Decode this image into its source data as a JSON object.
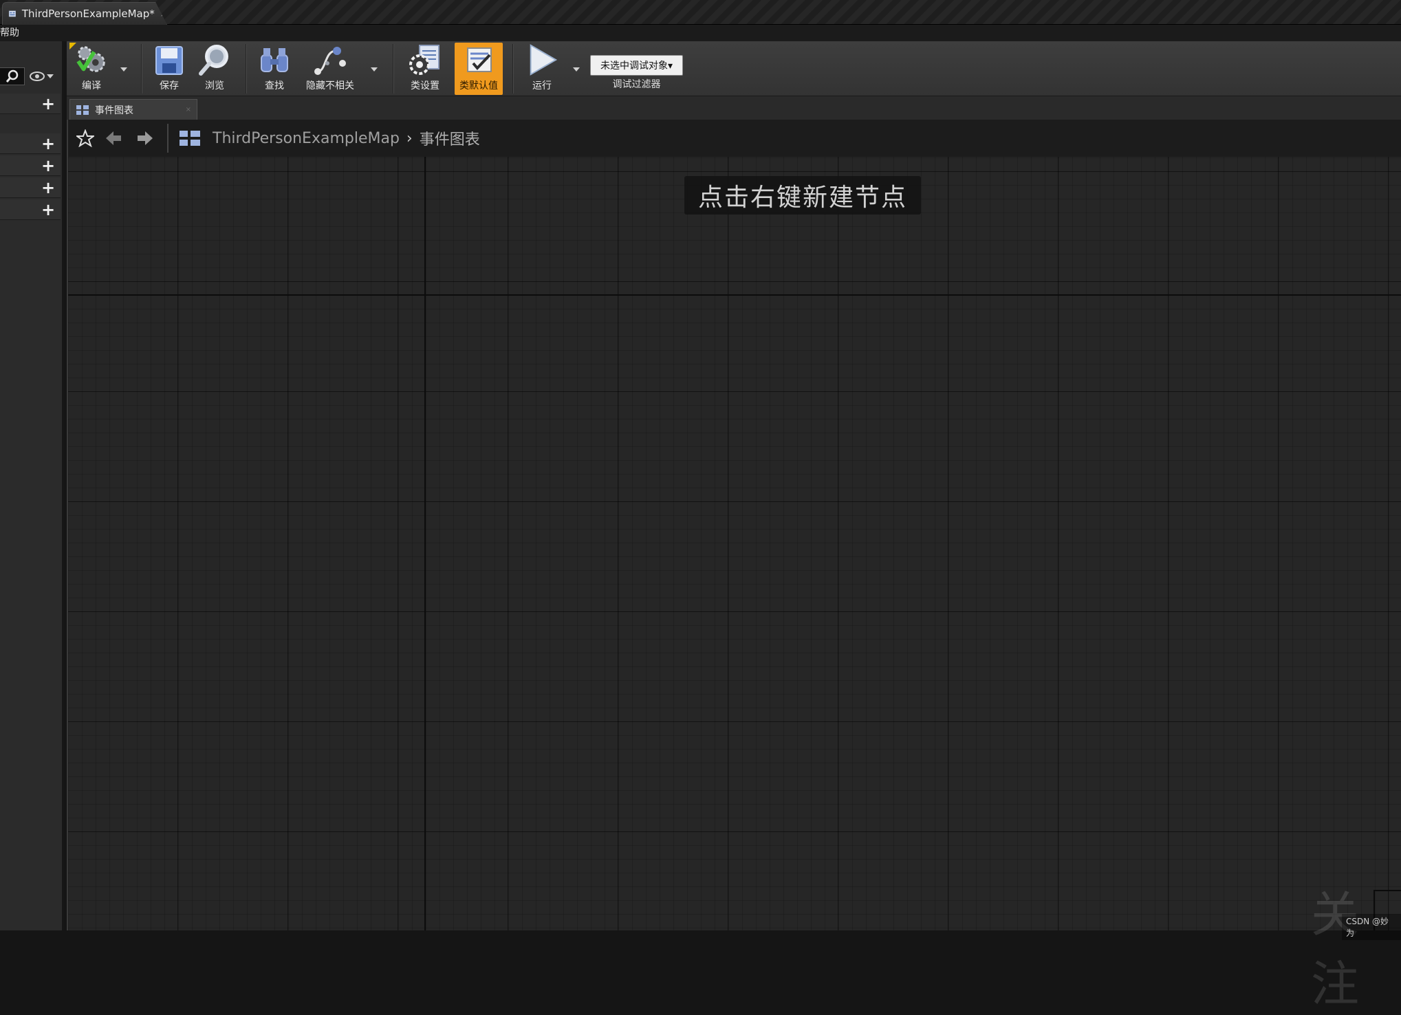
{
  "window": {
    "doc_tab_label": "ThirdPersonExampleMap",
    "doc_tab_dirty_mark": "*",
    "doc_tab_close": "×"
  },
  "menubar": {
    "help": "帮助"
  },
  "toolbar": {
    "compile": "编译",
    "save": "保存",
    "browse": "浏览",
    "find": "查找",
    "hide_unrelated": "隐藏不相关",
    "class_settings": "类设置",
    "class_defaults": "类默认值",
    "run": "运行",
    "debug_object": "未选中调试对象▾",
    "debug_filter": "调试过滤器"
  },
  "graph_tab": {
    "label": "事件图表",
    "close": "×"
  },
  "breadcrumb": {
    "map": "ThirdPersonExampleMap",
    "separator": "›",
    "current": "事件图表"
  },
  "graph": {
    "hint": "点击右键新建节点"
  },
  "left_panel": {
    "add_symbol": "+"
  },
  "watermark": {
    "text": "CSDN @妙为",
    "big_text": "关注"
  },
  "colors": {
    "accent_orange": "#f09a1e",
    "compile_green": "#46c23a",
    "graph_bg": "#262626"
  }
}
